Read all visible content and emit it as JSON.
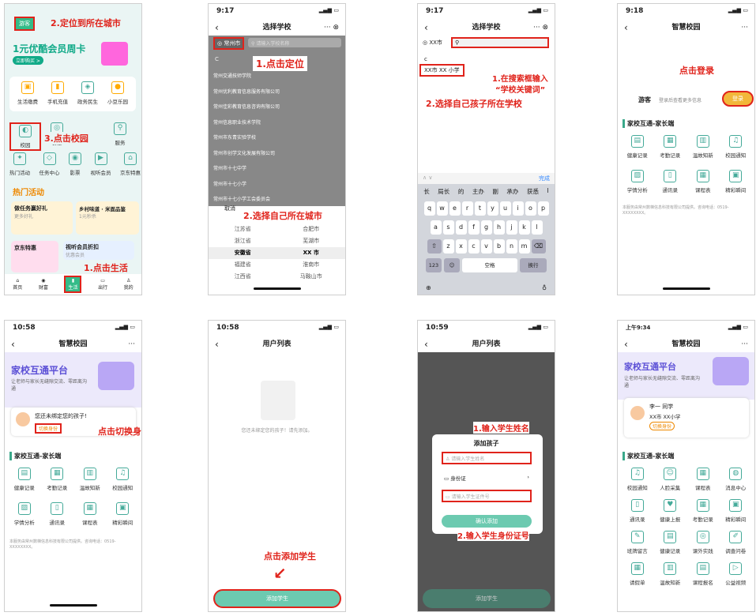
{
  "p1": {
    "city": "游客",
    "ann_city": "2.定位到所在城市",
    "banner_title": "1元优酷会员周卡",
    "banner_btn": "立即购买 >",
    "svc": [
      "生活缴费",
      "手机充值",
      "政务民生",
      "小豆乐园"
    ],
    "row2": [
      "校园",
      "食堂",
      "",
      "服务"
    ],
    "row3": [
      "热门活动",
      "任务中心",
      "影票",
      "视听会员",
      "京东特惠"
    ],
    "ann_campus": "3.点击校园",
    "hot": "热门活动",
    "tile1": "做任务赢好礼",
    "tile1b": "更多好礼",
    "tile2": "乡村味道 · 米面品鉴",
    "tile2b": "1元秒杀",
    "tile3": "京东特惠",
    "tile4": "视听会员折扣",
    "tile4b": "优惠会员",
    "ann_life": "1.点击生活",
    "tabs": [
      "首页",
      "财富",
      "生活",
      "出行",
      "我的"
    ]
  },
  "p2": {
    "time": "9:17",
    "title": "选择学校",
    "loc": "常州市",
    "search_ph": "请输入学校名称",
    "ann_loc": "1.点击定位",
    "letter": "C",
    "schools": [
      "常州交通技师学院",
      "常州优利教育信息服务有限公司",
      "常州佳彩教育信息咨询有限公司",
      "常州信息职业技术学院",
      "常州市东青实验学校",
      "常州市创学文化发展有限公司",
      "常州市十七中学",
      "常州市十七小学",
      "常州市十七小学工会委员会"
    ],
    "cancel": "取消",
    "ann_city": "2.选择自己所在城市",
    "prov": [
      "江苏省",
      "浙江省",
      "安徽省",
      "福建省",
      "江西省"
    ],
    "cities": [
      "合肥市",
      "芜湖市",
      "XX 市",
      "淮南市",
      "马鞍山市"
    ]
  },
  "p3": {
    "time": "9:17",
    "title": "选择学校",
    "loc": "XX市",
    "letter": "c",
    "result": "XX市 XX 小学",
    "ann1": "1.在搜索框输入",
    "ann1b": "“学校关键词”",
    "ann2": "2.选择自己孩子所在学校",
    "done": "完成",
    "cand": [
      "长",
      "局长",
      "的",
      "主办",
      "副",
      "承办",
      "获悉",
      "I"
    ],
    "k1": [
      "q",
      "w",
      "e",
      "r",
      "t",
      "y",
      "u",
      "i",
      "o",
      "p"
    ],
    "k2": [
      "a",
      "s",
      "d",
      "f",
      "g",
      "h",
      "j",
      "k",
      "l"
    ],
    "k3": [
      "z",
      "x",
      "c",
      "v",
      "b",
      "n",
      "m"
    ],
    "k_num": "123",
    "k_space": "空格",
    "k_enter": "换行"
  },
  "p4": {
    "time": "9:18",
    "title": "智慧校园",
    "ann": "点击登录",
    "guest": "游客",
    "guest_sub": "登录后查看更多信息",
    "login": "登录",
    "sec": "家校互通-家长端",
    "items": [
      "健康记录",
      "考勤记录",
      "温故知新",
      "校园通知",
      "学情分析",
      "通讯录",
      "课程表",
      "精彩瞬间"
    ],
    "foot": "本服务由常州数梯信息科技有限公司提供。咨询电话：0519-XXXXXXXX。"
  },
  "p5": {
    "time": "10:58",
    "title": "智慧校园",
    "hero": "家校互通平台",
    "hero_sub": "让老师与家长无缝隙交流、零距离沟通",
    "bind": "您还未绑定您的孩子!",
    "switch": "切换身份",
    "ann": "点击切换身份",
    "sec": "家校互通-家长端",
    "items": [
      "健康记录",
      "考勤记录",
      "温故知新",
      "校园通知",
      "学情分析",
      "通讯录",
      "课程表",
      "精彩瞬间"
    ],
    "foot": "本服务由常州数梯信息科技有限公司提供。咨询电话：0519-XXXXXXXX。"
  },
  "p6": {
    "time": "10:58",
    "title": "用户列表",
    "empty": "您还未绑定您的孩子！请先添加。",
    "ann": "点击添加学生",
    "btn": "添加学生"
  },
  "p7": {
    "time": "10:59",
    "title": "用户列表",
    "dlg": "添加孩子",
    "name_ph": "请输入学生姓名",
    "id_type": "身份证",
    "id_ph": "请输入学生证件号",
    "confirm": "确认添加",
    "ann1": "1.输入学生姓名",
    "ann2": "2.输入学生身份证号",
    "btn": "添加学生"
  },
  "p8": {
    "time": "上午9:34",
    "title": "智慧校园",
    "hero": "家校互通平台",
    "hero_sub": "让老师与家长无缝隙交流、零距离沟通",
    "student": "李一 同学",
    "school": "XX市 XX小学",
    "switch": "切换身份",
    "sec": "家校互通-家长端",
    "items": [
      "校园通知",
      "人脸采集",
      "课程表",
      "消息中心",
      "通讯录",
      "健康上报",
      "考勤记录",
      "精彩瞬间",
      "班牌留言",
      "健康记录",
      "课外实践",
      "调查问卷",
      "请假单",
      "温故知新",
      "课程报名",
      "公益视频"
    ]
  }
}
